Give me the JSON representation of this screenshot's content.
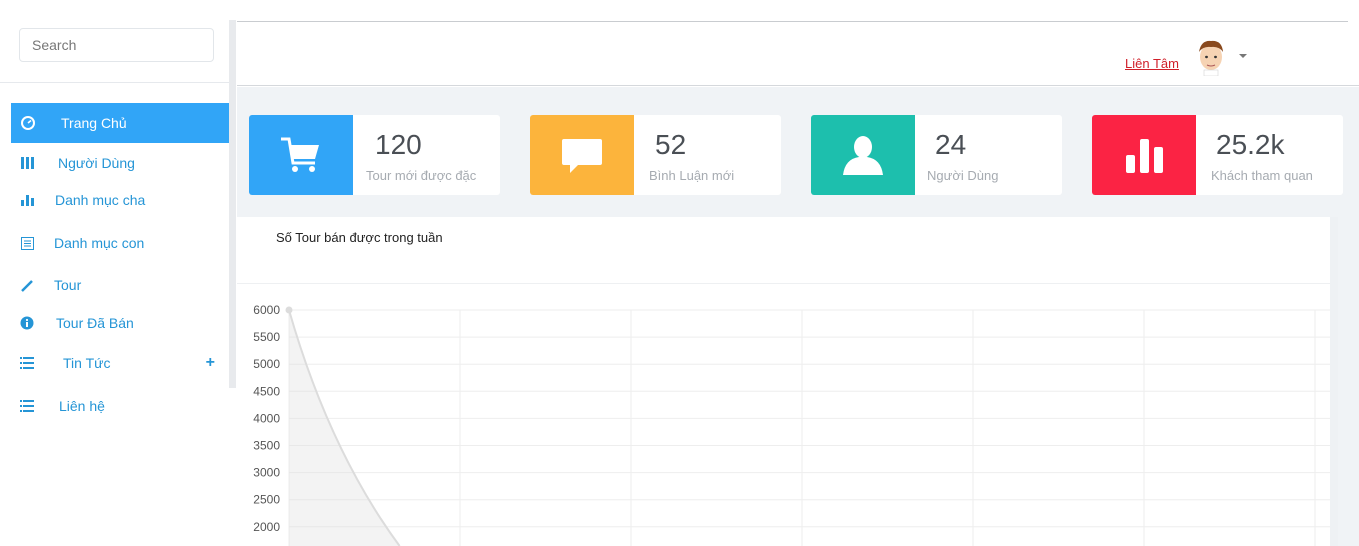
{
  "sidebar": {
    "search_placeholder": "Search",
    "items": [
      {
        "label": "Trang Chủ",
        "icon": "dashboard-icon"
      },
      {
        "label": "Người Dùng",
        "icon": "grid-icon"
      },
      {
        "label": "Danh mục cha",
        "icon": "bar-chart-icon"
      },
      {
        "label": "Danh mục con",
        "icon": "list-alt-icon"
      },
      {
        "label": "Tour",
        "icon": "pencil-icon"
      },
      {
        "label": "Tour Đã Bán",
        "icon": "info-icon"
      },
      {
        "label": "Tin Tức",
        "icon": "list-icon"
      },
      {
        "label": "Liên hệ",
        "icon": "list-icon"
      }
    ]
  },
  "header": {
    "user_name": "Liên Tâm"
  },
  "stats": [
    {
      "value": "120",
      "label": "Tour mới được đặc",
      "color": "#31a5f7",
      "icon": "cart-icon"
    },
    {
      "value": "52",
      "label": "Bình Luận mới",
      "color": "#fcb43c",
      "icon": "comment-icon"
    },
    {
      "value": "24",
      "label": "Người Dùng",
      "color": "#1dbfad",
      "icon": "user-icon"
    },
    {
      "value": "25.2k",
      "label": "Khách tham quan",
      "color": "#fb2344",
      "icon": "bar-chart-icon"
    }
  ],
  "panel": {
    "title": "Số Tour bán được trong tuần"
  },
  "chart_data": {
    "type": "line",
    "title": "Số Tour bán được trong tuần",
    "y_ticks": [
      "6000",
      "5500",
      "5000",
      "4500",
      "4000",
      "3500",
      "3000",
      "2500",
      "2000"
    ],
    "ylim": [
      2000,
      6000
    ],
    "series": [
      {
        "points": [
          [
            0,
            6000
          ],
          [
            0.6,
            2000
          ]
        ]
      }
    ],
    "grid": true
  }
}
